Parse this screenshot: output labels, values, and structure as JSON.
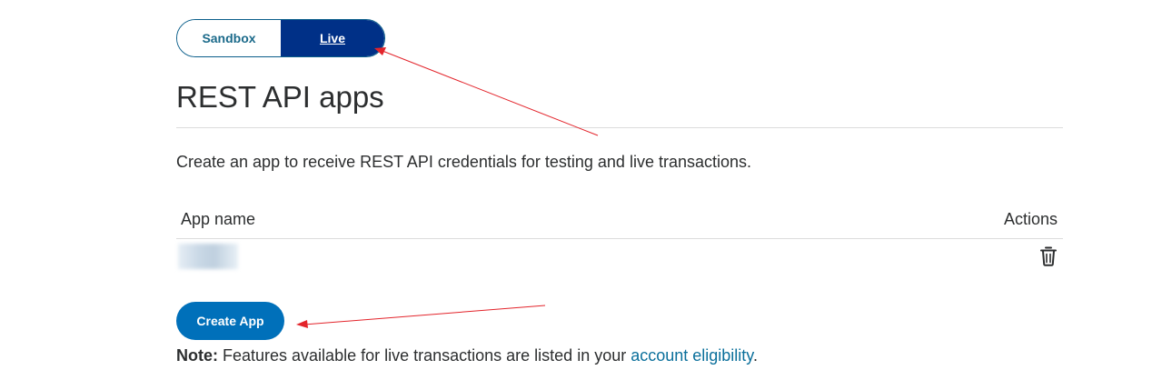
{
  "env_toggle": {
    "sandbox_label": "Sandbox",
    "live_label": "Live",
    "selected": "Live"
  },
  "page_title": "REST API apps",
  "description": "Create an app to receive REST API credentials for testing and live transactions.",
  "table": {
    "headers": {
      "app_name": "App name",
      "actions": "Actions"
    },
    "rows": [
      {
        "app_name": "",
        "actions": [
          "trash-icon"
        ]
      }
    ]
  },
  "create_app_label": "Create App",
  "note": {
    "label": "Note:",
    "text": " Features available for live transactions are listed in your ",
    "link_text": "account eligibility",
    "suffix": "."
  },
  "annotation_color": "#e3242b",
  "colors": {
    "live_bg": "#003087",
    "primary_button": "#0070ba",
    "link": "#0a6f9b"
  }
}
